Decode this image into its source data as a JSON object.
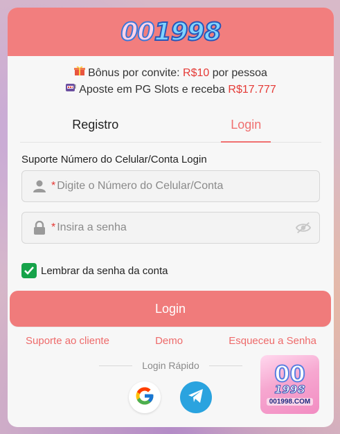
{
  "header": {
    "logo_part1": "00",
    "logo_part2": "1998"
  },
  "promo": {
    "line1_prefix": "Bônus por convite: ",
    "line1_value": "R$10",
    "line1_suffix": " por pessoa",
    "line2_prefix": "Aposte em PG Slots e receba ",
    "line2_value": "R$17.777"
  },
  "tabs": [
    {
      "label": "Registro",
      "active": false
    },
    {
      "label": "Login",
      "active": true
    }
  ],
  "form": {
    "label": "Suporte Número do Celular/Conta Login",
    "phone_placeholder": "Digite o Número do Celular/Conta",
    "password_placeholder": "Insira a senha",
    "required_mark": "*",
    "remember_label": "Lembrar da senha da conta",
    "remember_checked": true
  },
  "login_button": "Login",
  "links": {
    "support": "Suporte ao cliente",
    "demo": "Demo",
    "forgot": "Esqueceu a Senha"
  },
  "quick_login": {
    "label": "Login Rápido",
    "providers": [
      "google",
      "telegram"
    ]
  },
  "badge": {
    "top": "00",
    "middle": "1998",
    "domain": "001998.COM"
  },
  "colors": {
    "accent": "#f07b7b",
    "header": "#f27e7e",
    "price_red": "#e53935",
    "check_green": "#16a34a",
    "telegram": "#2aa3df"
  }
}
